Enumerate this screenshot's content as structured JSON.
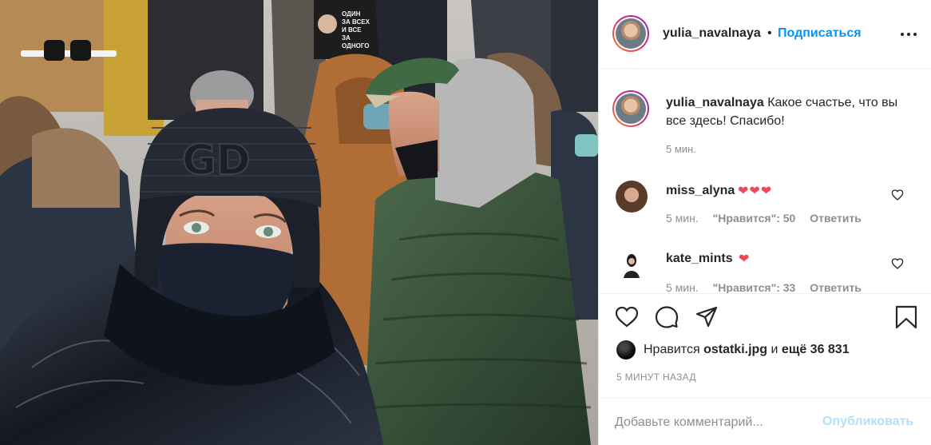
{
  "post": {
    "username": "yulia_navalnaya",
    "separator": "•",
    "follow_label": "Подписаться",
    "more_icon": "more-horizontal-icon"
  },
  "photo": {
    "sign_text_line1": "ОДИН",
    "sign_text_line2": "ЗА ВСЕХ",
    "sign_text_line3": "И ВСЕ",
    "sign_text_line4": "ЗА",
    "sign_text_line5": "ОДНОГО",
    "hat_logo": "GD"
  },
  "caption": {
    "username": "yulia_navalnaya",
    "text": "Какое счастье, что вы все здесь! Спасибо!",
    "time": "5 мин."
  },
  "comments": [
    {
      "username": "miss_alyna",
      "text": "❤❤❤",
      "time": "5 мин.",
      "likes": "\"Нравится\": 50",
      "reply": "Ответить"
    },
    {
      "username": "kate_mints",
      "text": "❤",
      "time": "5 мин.",
      "likes": "\"Нравится\": 33",
      "reply": "Ответить"
    }
  ],
  "actions": {
    "like_icon": "heart-icon",
    "comment_icon": "comment-icon",
    "share_icon": "paper-plane-icon",
    "save_icon": "bookmark-icon"
  },
  "likes": {
    "prefix": "Нравится",
    "user": "ostatki.jpg",
    "connector": "и",
    "count": "ещё 36 831"
  },
  "timestamp": "5 МИНУТ НАЗАД",
  "comment_form": {
    "placeholder": "Добавьте комментарий...",
    "submit_label": "Опубликовать"
  },
  "colors": {
    "accent": "#0095f6",
    "heart": "#ed4956",
    "muted": "#8e8e8e",
    "publish_disabled": "#b2dffc"
  }
}
